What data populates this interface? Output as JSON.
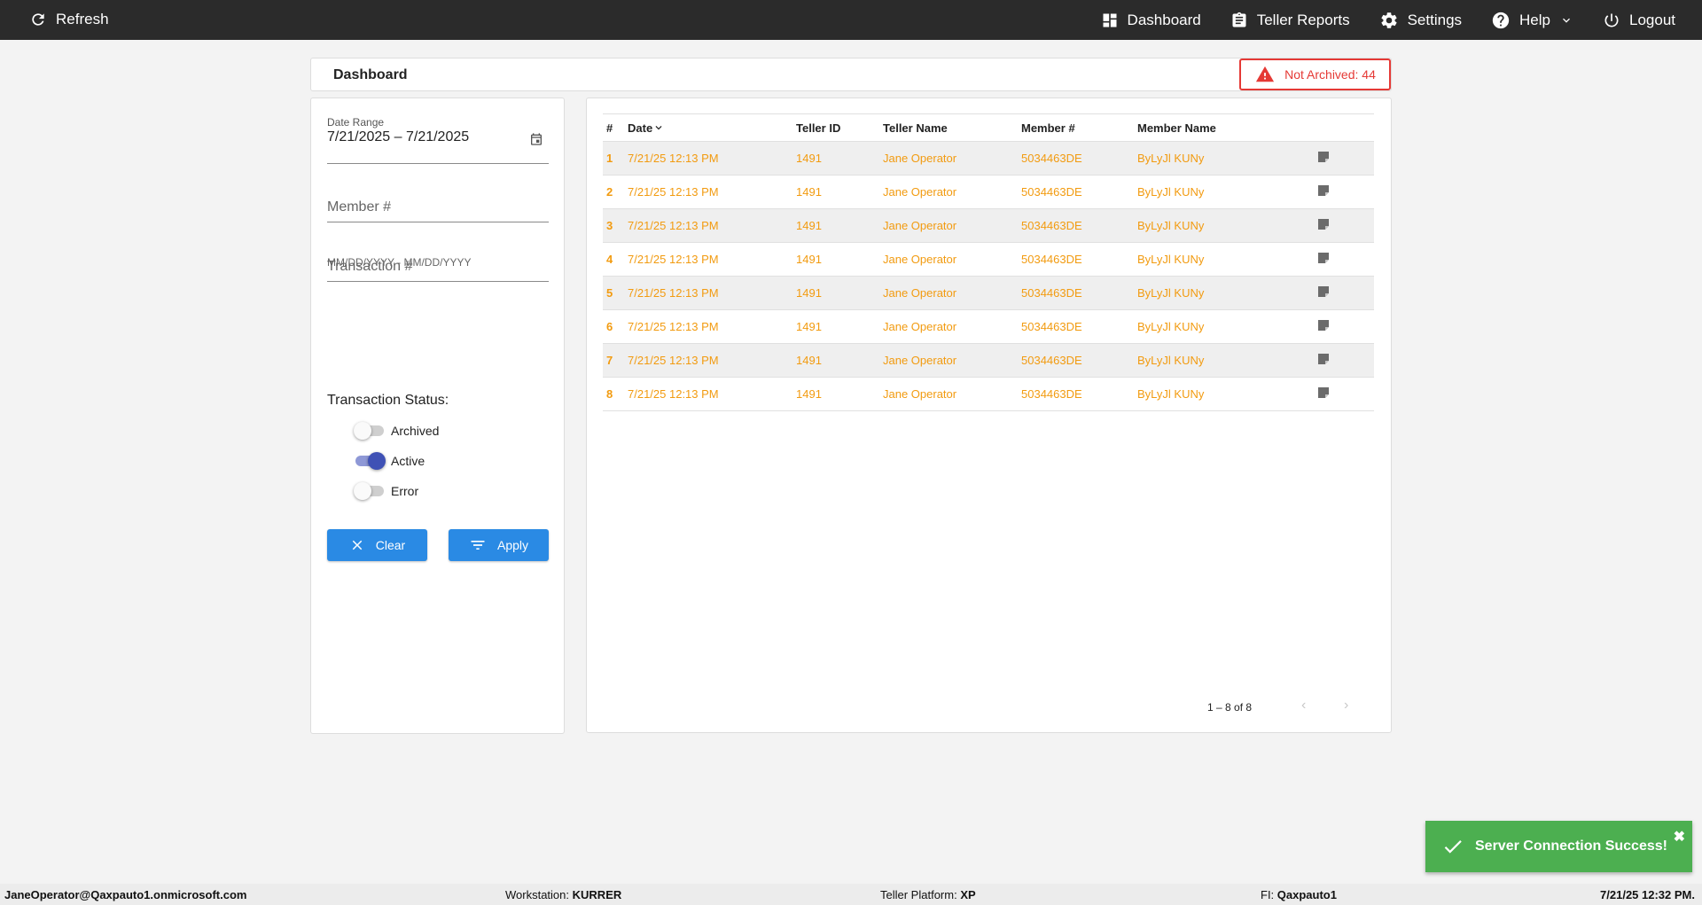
{
  "topbar": {
    "refresh_label": "Refresh",
    "nav": [
      {
        "label": "Dashboard",
        "icon": "dashboard-icon"
      },
      {
        "label": "Teller Reports",
        "icon": "clipboard-icon"
      },
      {
        "label": "Settings",
        "icon": "gear-icon"
      },
      {
        "label": "Help",
        "icon": "help-icon"
      },
      {
        "label": "Logout",
        "icon": "power-icon"
      }
    ]
  },
  "header": {
    "title": "Dashboard",
    "not_archived_label": "Not Archived: 44"
  },
  "filters": {
    "date_range_label": "Date Range",
    "date_range_value": "7/21/2025 – 7/21/2025",
    "date_hint": "MM/DD/YYYY - MM/DD/YYYY",
    "member_placeholder": "Member #",
    "transaction_placeholder": "Transaction #",
    "status_label": "Transaction Status:",
    "statuses": [
      {
        "label": "Archived",
        "on": false
      },
      {
        "label": "Active",
        "on": true
      },
      {
        "label": "Error",
        "on": false
      }
    ],
    "clear_label": "Clear",
    "apply_label": "Apply"
  },
  "table": {
    "headers": {
      "index": "#",
      "date": "Date",
      "teller_id": "Teller ID",
      "teller_name": "Teller Name",
      "member": "Member #",
      "member_name": "Member Name"
    },
    "rows": [
      {
        "index": "1",
        "date": "7/21/25 12:13 PM",
        "teller_id": "1491",
        "teller_name": "Jane Operator",
        "member": "5034463DE",
        "member_name": "ByLyJl KUNy"
      },
      {
        "index": "2",
        "date": "7/21/25 12:13 PM",
        "teller_id": "1491",
        "teller_name": "Jane Operator",
        "member": "5034463DE",
        "member_name": "ByLyJl KUNy"
      },
      {
        "index": "3",
        "date": "7/21/25 12:13 PM",
        "teller_id": "1491",
        "teller_name": "Jane Operator",
        "member": "5034463DE",
        "member_name": "ByLyJl KUNy"
      },
      {
        "index": "4",
        "date": "7/21/25 12:13 PM",
        "teller_id": "1491",
        "teller_name": "Jane Operator",
        "member": "5034463DE",
        "member_name": "ByLyJl KUNy"
      },
      {
        "index": "5",
        "date": "7/21/25 12:13 PM",
        "teller_id": "1491",
        "teller_name": "Jane Operator",
        "member": "5034463DE",
        "member_name": "ByLyJl KUNy"
      },
      {
        "index": "6",
        "date": "7/21/25 12:13 PM",
        "teller_id": "1491",
        "teller_name": "Jane Operator",
        "member": "5034463DE",
        "member_name": "ByLyJl KUNy"
      },
      {
        "index": "7",
        "date": "7/21/25 12:13 PM",
        "teller_id": "1491",
        "teller_name": "Jane Operator",
        "member": "5034463DE",
        "member_name": "ByLyJl KUNy"
      },
      {
        "index": "8",
        "date": "7/21/25 12:13 PM",
        "teller_id": "1491",
        "teller_name": "Jane Operator",
        "member": "5034463DE",
        "member_name": "ByLyJl KUNy"
      }
    ],
    "pagination": "1 – 8 of 8"
  },
  "toast": {
    "message": "Server Connection Success!",
    "close": "✖"
  },
  "footer": {
    "user": "JaneOperator@Qaxpauto1.onmicrosoft.com",
    "workstation_label": "Workstation:",
    "workstation": "KURRER",
    "platform_label": "Teller Platform:",
    "platform": "XP",
    "fi_label": "FI:",
    "fi": "Qaxpauto1",
    "datetime": "7/21/25 12:32 PM."
  },
  "colors": {
    "topbar": "#2b2b2b",
    "accent_blue": "#2a8ae4",
    "row_text": "#f29b10",
    "alert_red": "#e53935",
    "toast_green": "#4caf50",
    "toggle_on": "#3f51b5"
  }
}
